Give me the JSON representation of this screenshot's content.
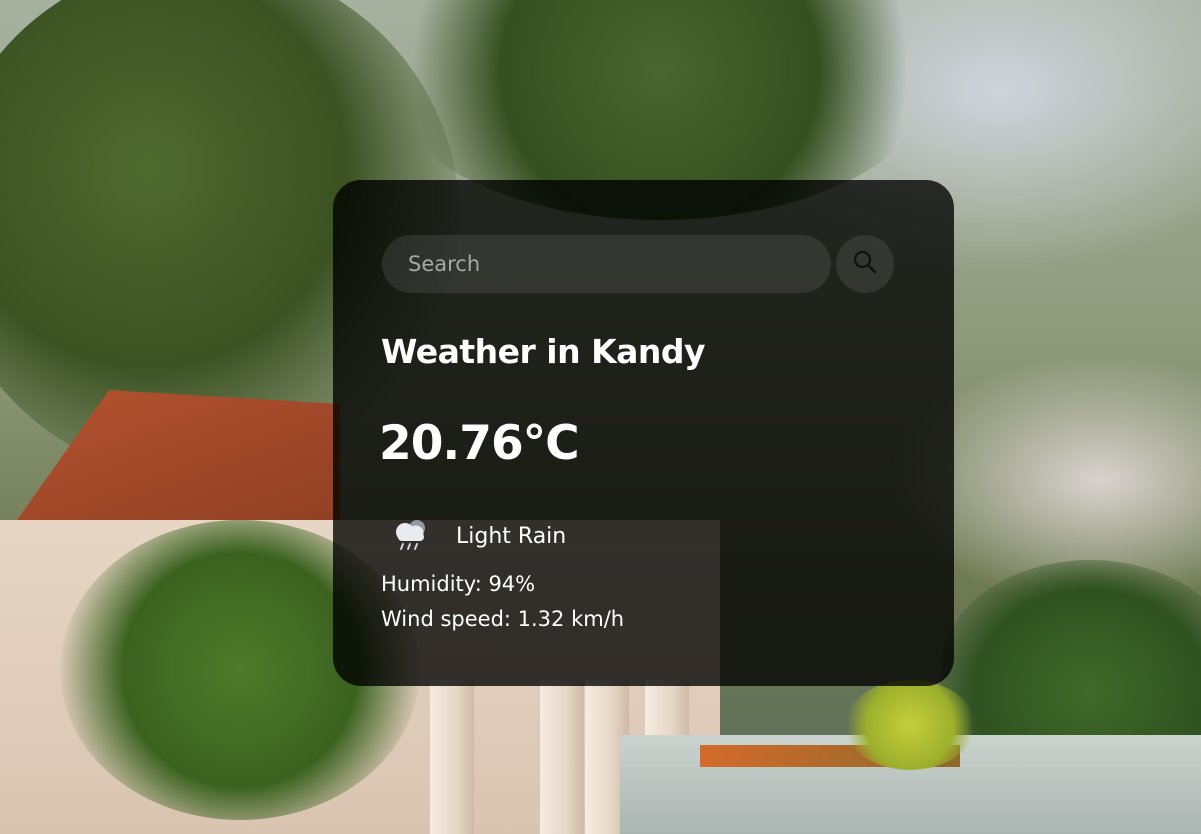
{
  "search": {
    "placeholder": "Search",
    "value": ""
  },
  "weather": {
    "title": "Weather in Kandy",
    "temperature": "20.76°C",
    "condition": "Light Rain",
    "condition_icon": "rain-cloud-icon",
    "humidity": "Humidity: 94%",
    "wind": "Wind speed: 1.32 km/h"
  },
  "colors": {
    "card_background": "#000000",
    "text": "#ffffff",
    "placeholder": "#a7a7a7"
  }
}
